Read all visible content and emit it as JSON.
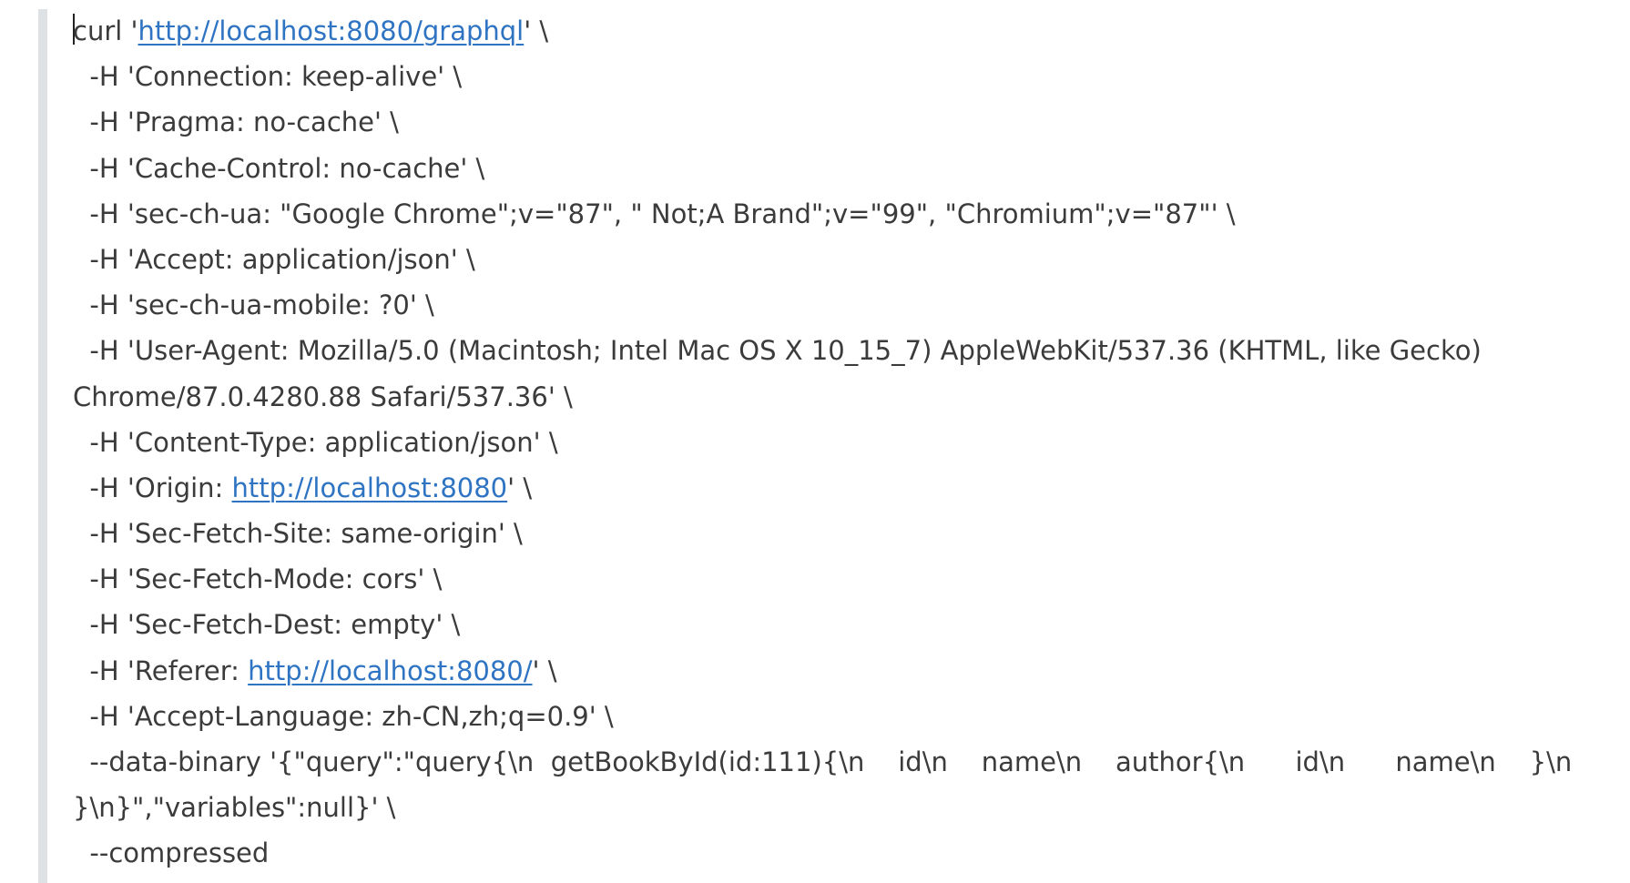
{
  "document": {
    "line_1": {
      "prefix": "curl '",
      "link": "http://localhost:8080/graphql",
      "suffix": "' \\"
    },
    "line_2": "  -H 'Connection: keep-alive' \\",
    "line_3": "  -H 'Pragma: no-cache' \\",
    "line_4": "  -H 'Cache-Control: no-cache' \\",
    "line_5": "  -H 'sec-ch-ua: \"Google Chrome\";v=\"87\", \" Not;A Brand\";v=\"99\", \"Chromium\";v=\"87\"' \\",
    "line_6": "  -H 'Accept: application/json' \\",
    "line_7": "  -H 'sec-ch-ua-mobile: ?0' \\",
    "line_8a": "  -H 'User-Agent: Mozilla/5.0 (Macintosh; Intel Mac OS X 10_15_7) AppleWebKit/537.36 (KHTML, like Gecko)",
    "line_8b": "Chrome/87.0.4280.88 Safari/537.36' \\",
    "line_9": "  -H 'Content-Type: application/json' \\",
    "line_10": {
      "prefix": "  -H 'Origin: ",
      "link": "http://localhost:8080",
      "suffix": "' \\"
    },
    "line_11": "  -H 'Sec-Fetch-Site: same-origin' \\",
    "line_12": "  -H 'Sec-Fetch-Mode: cors' \\",
    "line_13": "  -H 'Sec-Fetch-Dest: empty' \\",
    "line_14": {
      "prefix": "  -H 'Referer: ",
      "link": "http://localhost:8080/",
      "suffix": "' \\"
    },
    "line_15": "  -H 'Accept-Language: zh-CN,zh;q=0.9' \\",
    "line_16a": "  --data-binary '{\"query\":\"query{\\n  getBookById(id:111){\\n    id\\n    name\\n    author{\\n      id\\n      name\\n    }\\n",
    "line_16b": "}\\n}\",\"variables\":null}' \\",
    "line_17": "  --compressed"
  }
}
